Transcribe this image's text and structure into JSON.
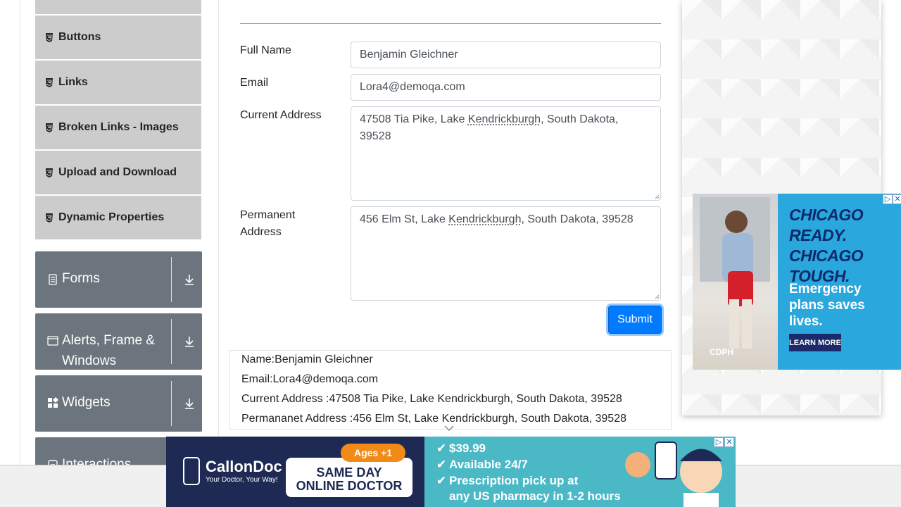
{
  "sidebar": {
    "sub_items": [
      {
        "label": "Buttons"
      },
      {
        "label": "Links"
      },
      {
        "label": "Broken Links - Images"
      },
      {
        "label": "Upload and Download"
      },
      {
        "label": "Dynamic Properties"
      }
    ],
    "groups": [
      {
        "label": "Forms",
        "icon": "document-icon"
      },
      {
        "label": "Alerts, Frame & Windows",
        "icon": "window-icon"
      },
      {
        "label": "Widgets",
        "icon": "widgets-icon"
      },
      {
        "label": "Interactions",
        "icon": "interactions-icon"
      }
    ]
  },
  "form": {
    "full_name_label": "Full Name",
    "full_name_value": "Benjamin Gleichner",
    "email_label": "Email",
    "email_value": "Lora4@demoqa.com",
    "current_address_label": "Current Address",
    "current_address_value_pre": "47508 Tia Pike, Lake ",
    "current_address_value_mark": "Kendrickburgh",
    "current_address_value_post": ", South Dakota, 39528",
    "permanent_address_label_line1": "Permanent",
    "permanent_address_label_line2": "Address",
    "permanent_address_value_pre": "456 Elm St, Lake ",
    "permanent_address_value_mark": "Kendrickburgh",
    "permanent_address_value_post": ", South Dakota, 39528",
    "submit_label": "Submit"
  },
  "output": {
    "name": "Name:Benjamin Gleichner",
    "email": "Email:Lora4@demoqa.com",
    "current_address": "Current Address :47508 Tia Pike, Lake Kendrickburgh, South Dakota, 39528",
    "permanent_address": "Permananet Address :456 Elm St, Lake Kendrickburgh, South Dakota, 39528"
  },
  "ad_right": {
    "headline_line1": "CHICAGO READY.",
    "headline_line2": "CHICAGO TOUGH.",
    "subtext": "Emergency plans saves lives.",
    "button": "LEARN MORE",
    "sponsor": "CDPH"
  },
  "ad_bottom": {
    "brand": "CallonDoc",
    "tagline": "Your Doctor, Your Way!",
    "ages_badge": "Ages +1",
    "headline_line1": "SAME DAY",
    "headline_line2": "ONLINE DOCTOR",
    "bullets": [
      "$39.99",
      "Available 24/7",
      "Prescription pick up at",
      "any US pharmacy in 1-2 hours"
    ]
  },
  "colors": {
    "submit_blue": "#007bff",
    "sidebar_group": "#6c757d",
    "sidebar_item": "#cccccc"
  }
}
